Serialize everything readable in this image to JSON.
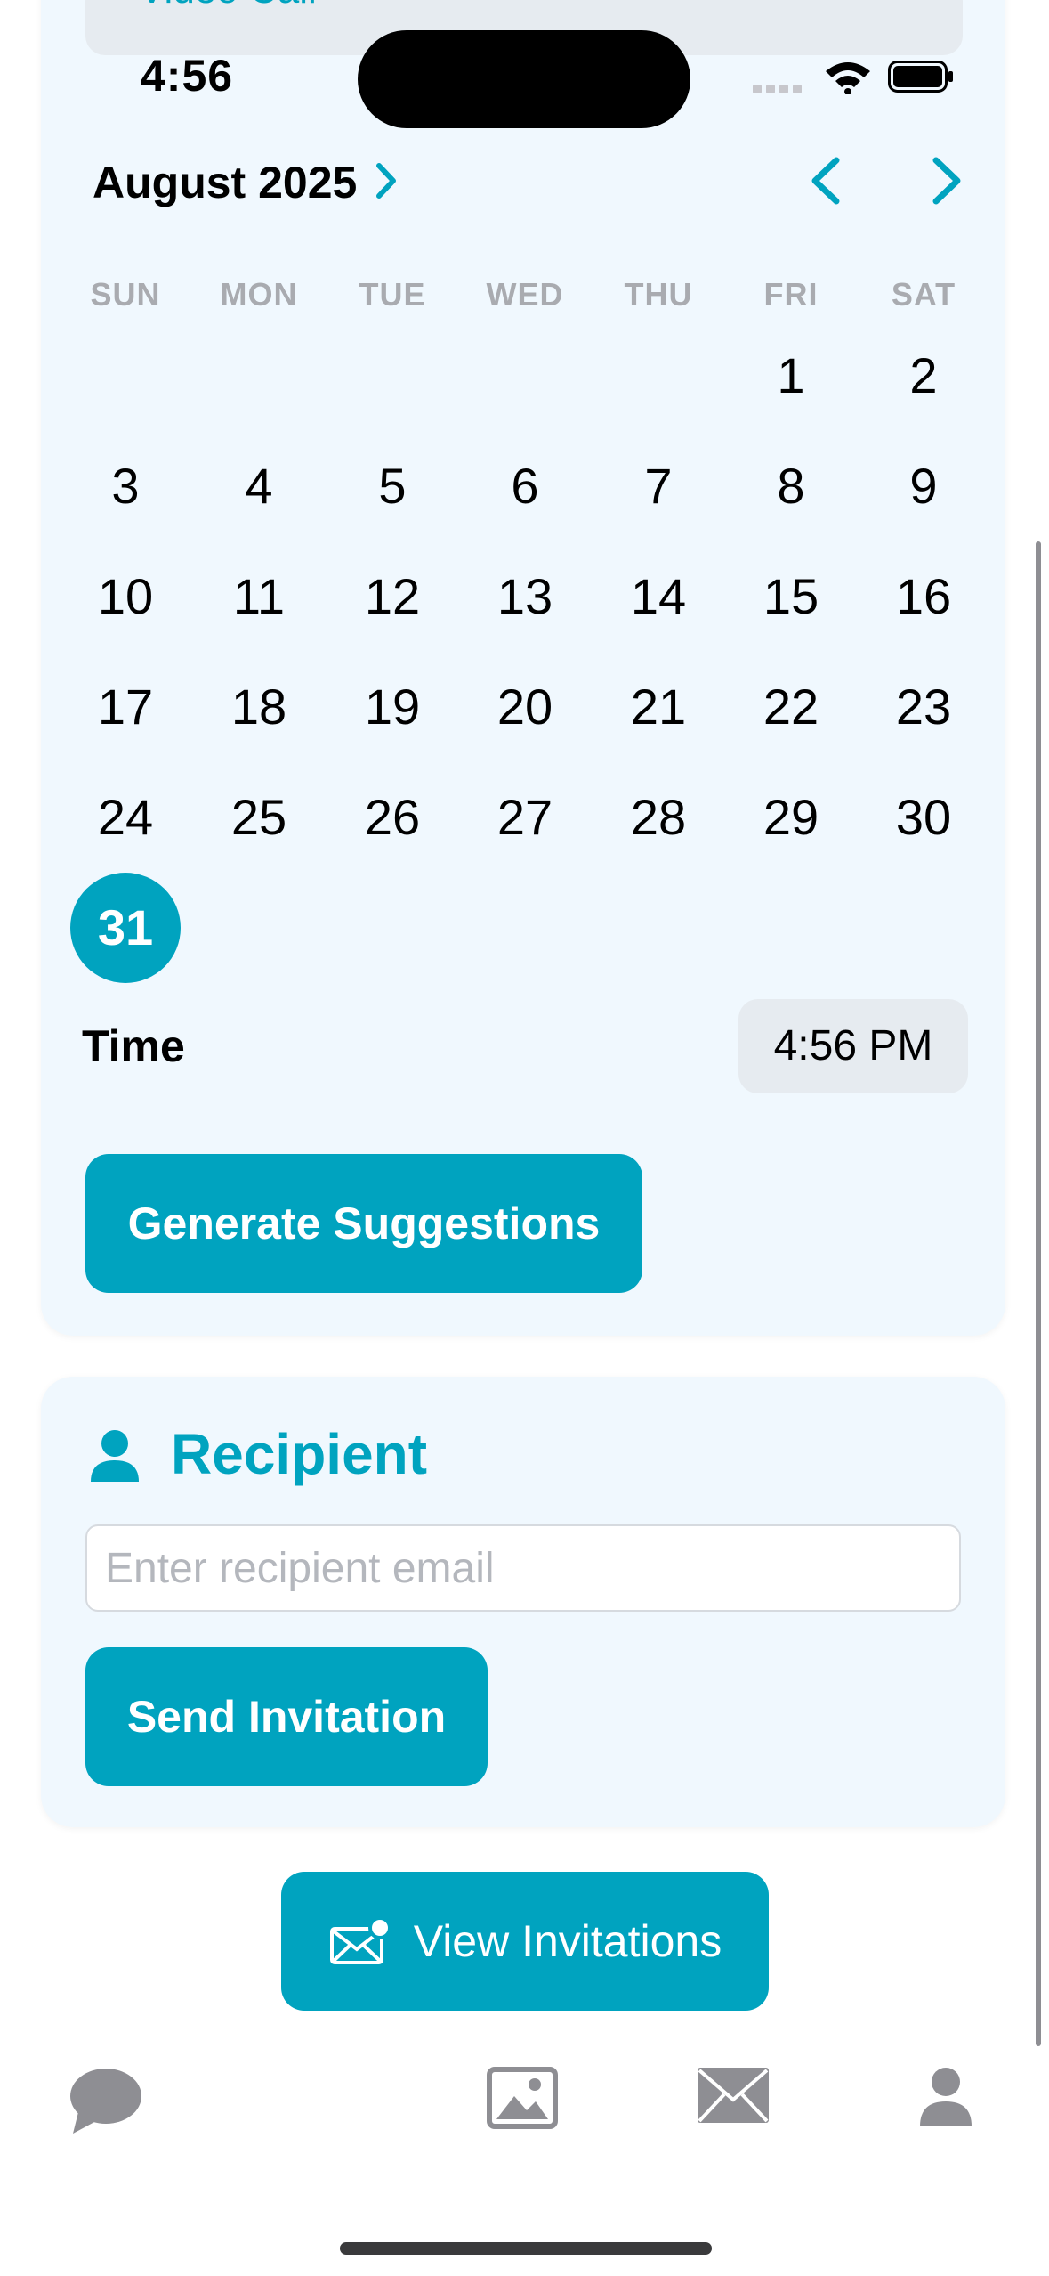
{
  "status_bar": {
    "time": "4:56"
  },
  "top_chip": {
    "label": "Video Call"
  },
  "calendar": {
    "month_label": "August 2025",
    "weekdays": [
      "SUN",
      "MON",
      "TUE",
      "WED",
      "THU",
      "FRI",
      "SAT"
    ],
    "days": [
      "1",
      "2",
      "3",
      "4",
      "5",
      "6",
      "7",
      "8",
      "9",
      "10",
      "11",
      "12",
      "13",
      "14",
      "15",
      "16",
      "17",
      "18",
      "19",
      "20",
      "21",
      "22",
      "23",
      "24",
      "25",
      "26",
      "27",
      "28",
      "29",
      "30",
      "31"
    ],
    "selected_day": "31"
  },
  "time": {
    "label": "Time",
    "value": "4:56 PM"
  },
  "buttons": {
    "generate": "Generate Suggestions",
    "send": "Send Invitation",
    "view": "View Invitations"
  },
  "recipient": {
    "title": "Recipient",
    "email_placeholder": "Enter recipient email",
    "email_value": ""
  },
  "tabs": [
    {
      "icon": "chat-bubble-icon"
    },
    {
      "icon": "photo-icon"
    },
    {
      "icon": "envelope-icon"
    },
    {
      "icon": "profile-icon"
    }
  ],
  "colors": {
    "accent": "#00a3bf",
    "card_bg": "#f0f8fe",
    "chip_bg": "#e6ebf0",
    "tab_icon": "#8e8e93"
  }
}
